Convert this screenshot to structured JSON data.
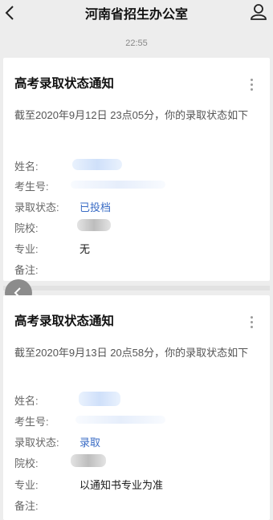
{
  "header": {
    "title": "河南省招生办公室"
  },
  "timestamp": "22:55",
  "notifications": [
    {
      "title": "高考录取状态通知",
      "summary": "截至2020年9月12日 23点05分，你的录取状态如下",
      "fields": [
        {
          "label": "姓名:",
          "value": ""
        },
        {
          "label": "考生号:",
          "value": ""
        },
        {
          "label": "录取状态:",
          "value": "已投档"
        },
        {
          "label": "院校:",
          "value": ""
        },
        {
          "label": "专业:",
          "value": "无"
        },
        {
          "label": "备注:",
          "value": ""
        }
      ]
    },
    {
      "title": "高考录取状态通知",
      "summary": "截至2020年9月13日 20点58分，你的录取状态如下",
      "fields": [
        {
          "label": "姓名:",
          "value": ""
        },
        {
          "label": "考生号:",
          "value": ""
        },
        {
          "label": "录取状态:",
          "value": "录取"
        },
        {
          "label": "院校:",
          "value": ""
        },
        {
          "label": "专业:",
          "value": "以通知书专业为准"
        },
        {
          "label": "备注:",
          "value": ""
        }
      ]
    }
  ],
  "colors": {
    "background": "#ededed",
    "card": "#ffffff",
    "link": "#3a6cc5",
    "muted": "#888888"
  },
  "icons": [
    "back-arrow-icon",
    "user-profile-icon",
    "more-vertical-icon",
    "back-chevron-icon"
  ]
}
